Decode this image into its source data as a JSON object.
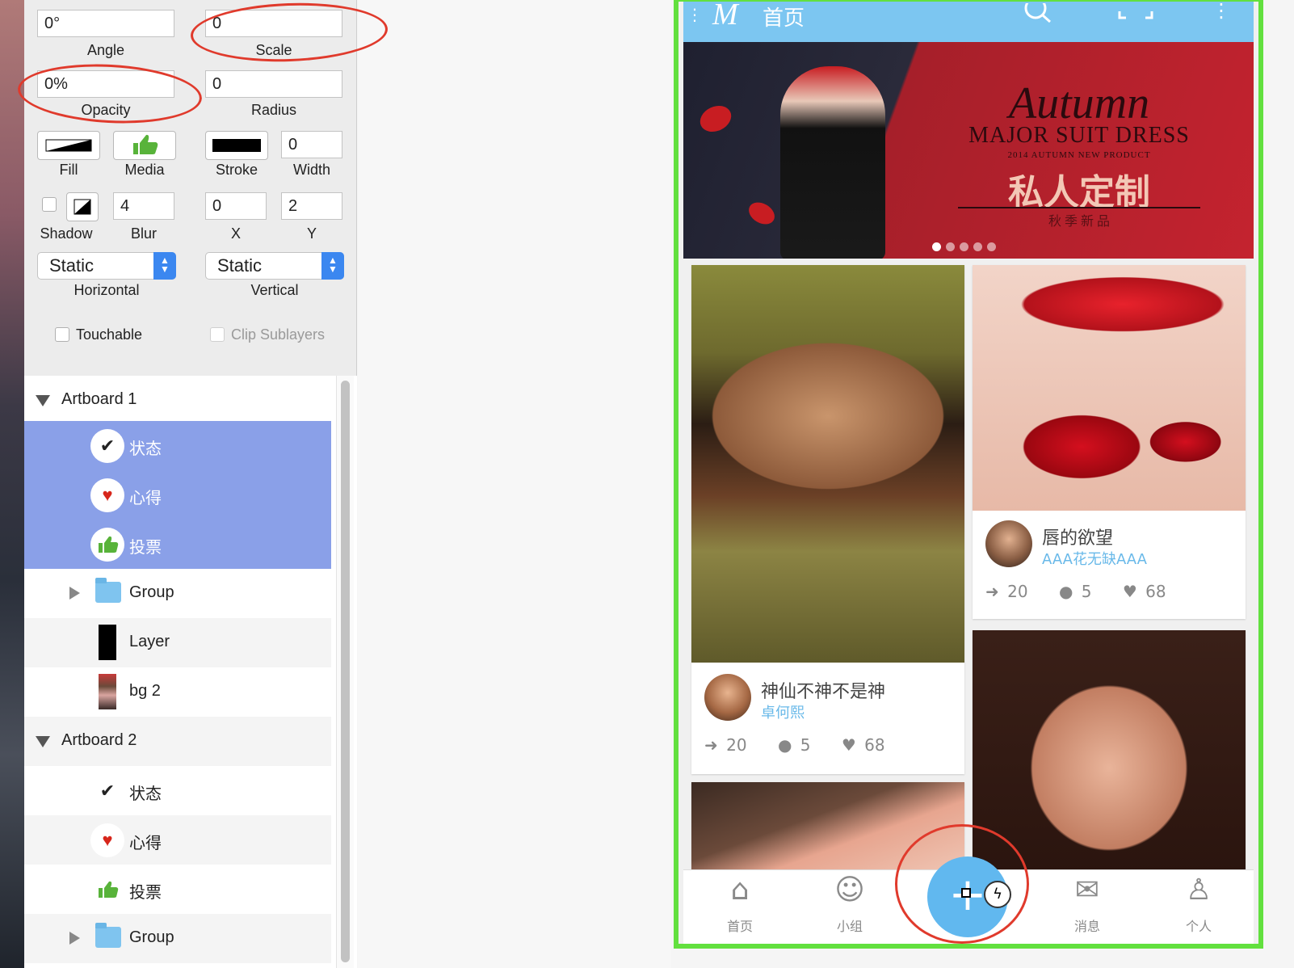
{
  "inspector": {
    "angle": {
      "value": "0°",
      "label": "Angle"
    },
    "scale": {
      "value": "0",
      "label": "Scale"
    },
    "opacity": {
      "value": "0%",
      "label": "Opacity"
    },
    "radius": {
      "value": "0",
      "label": "Radius"
    },
    "fill_label": "Fill",
    "media_label": "Media",
    "stroke_label": "Stroke",
    "width": {
      "value": "0",
      "label": "Width"
    },
    "shadow_label": "Shadow",
    "blur": {
      "value": "4",
      "label": "Blur"
    },
    "x": {
      "value": "0",
      "label": "X"
    },
    "y": {
      "value": "2",
      "label": "Y"
    },
    "horizontal": {
      "value": "Static",
      "label": "Horizontal"
    },
    "vertical": {
      "value": "Static",
      "label": "Vertical"
    },
    "touchable_label": "Touchable",
    "clip_label": "Clip Sublayers"
  },
  "layers": [
    {
      "label": "Artboard 1",
      "type": "artboard"
    },
    {
      "label": "状态",
      "icon": "check-icon",
      "selected": true
    },
    {
      "label": "心得",
      "icon": "heart-icon",
      "selected": true
    },
    {
      "label": "投票",
      "icon": "thumbs-up-icon",
      "selected": true
    },
    {
      "label": "Group",
      "icon": "folder-icon"
    },
    {
      "label": "Layer",
      "icon": "black-layer-icon"
    },
    {
      "label": "bg 2",
      "icon": "image-thumb-icon"
    },
    {
      "label": "Artboard 2",
      "type": "artboard"
    },
    {
      "label": "状态",
      "icon": "check-icon"
    },
    {
      "label": "心得",
      "icon": "heart-icon"
    },
    {
      "label": "投票",
      "icon": "thumbs-up-icon"
    },
    {
      "label": "Group",
      "icon": "folder-icon"
    }
  ],
  "phone": {
    "header_title": "首页",
    "banner": {
      "script": "Autumn",
      "headline": "MAJOR SUIT DRESS",
      "sub": "2014 AUTUMN NEW PRODUCT",
      "cn_title": "私人定制",
      "cn_sub": "秋 季 新 品",
      "page_count": 5,
      "active_index": 0
    },
    "cards": [
      {
        "title": "神仙不神不是神",
        "author": "卓何熙",
        "shares": "20",
        "comments": "5",
        "likes": "68"
      },
      {
        "title": "唇的欲望",
        "author": "AAA花无缺AAA",
        "shares": "20",
        "comments": "5",
        "likes": "68"
      }
    ],
    "tabs": [
      {
        "label": "首页",
        "icon": "home-icon"
      },
      {
        "label": "小组",
        "icon": "group-icon"
      },
      {
        "label": "消息",
        "icon": "mail-icon"
      },
      {
        "label": "个人",
        "icon": "person-icon"
      }
    ],
    "fab_icon": "plus-icon"
  },
  "colors": {
    "selection": "#8aa0e8",
    "phone_border": "#62e03e",
    "accent_blue": "#7cc6f1",
    "annotation_red": "#e03a2c"
  }
}
